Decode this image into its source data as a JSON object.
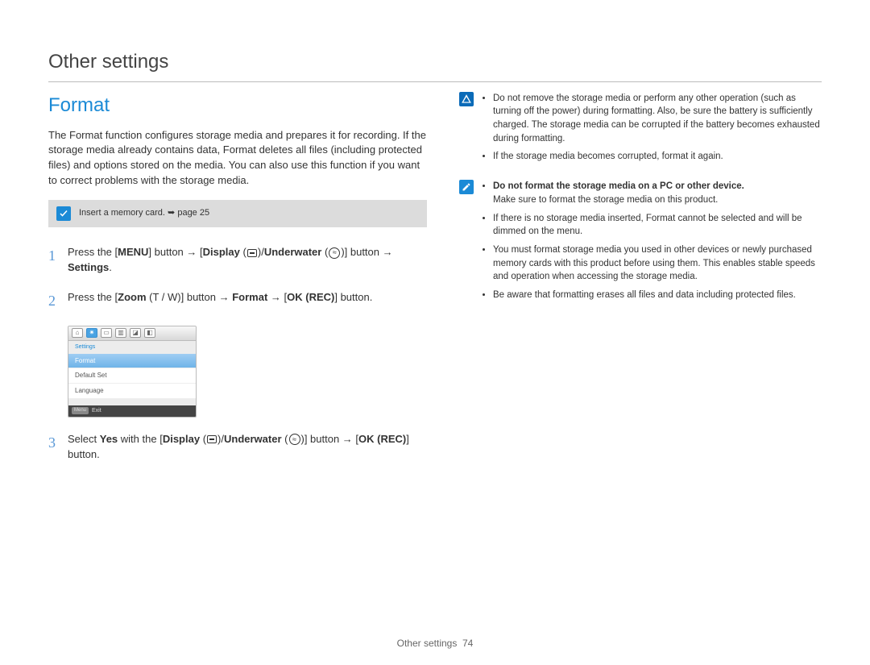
{
  "header": {
    "chapter_title": "Other settings"
  },
  "section": {
    "title": "Format"
  },
  "intro": "The Format function configures storage media and prepares it for recording. If the storage media already contains data, Format deletes all files (including protected files) and options stored on the media. You can also use this function if you want to correct problems with the storage media.",
  "note": {
    "text": "Insert a memory card. ",
    "page_ref": "page 25"
  },
  "steps": [
    {
      "num": "1",
      "pre": "Press the [",
      "menu": "MENU",
      "mid1": "] button → [",
      "display": "Display",
      "slash": "/",
      "underwater": "Underwater",
      "mid2": ")] button → ",
      "settings": "Settings",
      "end": "."
    },
    {
      "num": "2",
      "pre": "Press the [",
      "zoom": "Zoom",
      "tw": " (T / W)] button → ",
      "format": "Format",
      "arrow2": " → [",
      "okrec": "OK (REC)",
      "end": "] button."
    },
    {
      "num": "3",
      "pre": "Select ",
      "yes": "Yes",
      "mid1": " with the [",
      "display": "Display",
      "slash": "/",
      "underwater": "Underwater",
      "mid2": ")] button → [",
      "okrec": "OK (REC)",
      "end": "] button."
    }
  ],
  "screen": {
    "menu_header": "Settings",
    "items": [
      "Format",
      "Default Set",
      "Language"
    ],
    "footer_btn": "Menu",
    "footer_text": "Exit"
  },
  "warnings": [
    "Do not remove the storage media or perform any other operation (such as turning off the power) during formatting. Also, be sure the battery is sufficiently charged. The storage media can be corrupted if the battery becomes exhausted during formatting.",
    "If the storage media becomes corrupted, format it again."
  ],
  "notes2": {
    "bold_line": "Do not format the storage media on a PC or other device.",
    "sub_line": "Make sure to format the storage media on this product.",
    "bullets": [
      "If there is no storage media inserted, Format cannot be selected and will be dimmed on the menu.",
      "You must format storage media you used in other devices or newly purchased memory cards with this product before using them. This enables stable speeds and operation when accessing the storage media.",
      "Be aware that formatting erases all files and data including protected files."
    ]
  },
  "footer": {
    "chapter": "Other settings",
    "page": "74"
  }
}
